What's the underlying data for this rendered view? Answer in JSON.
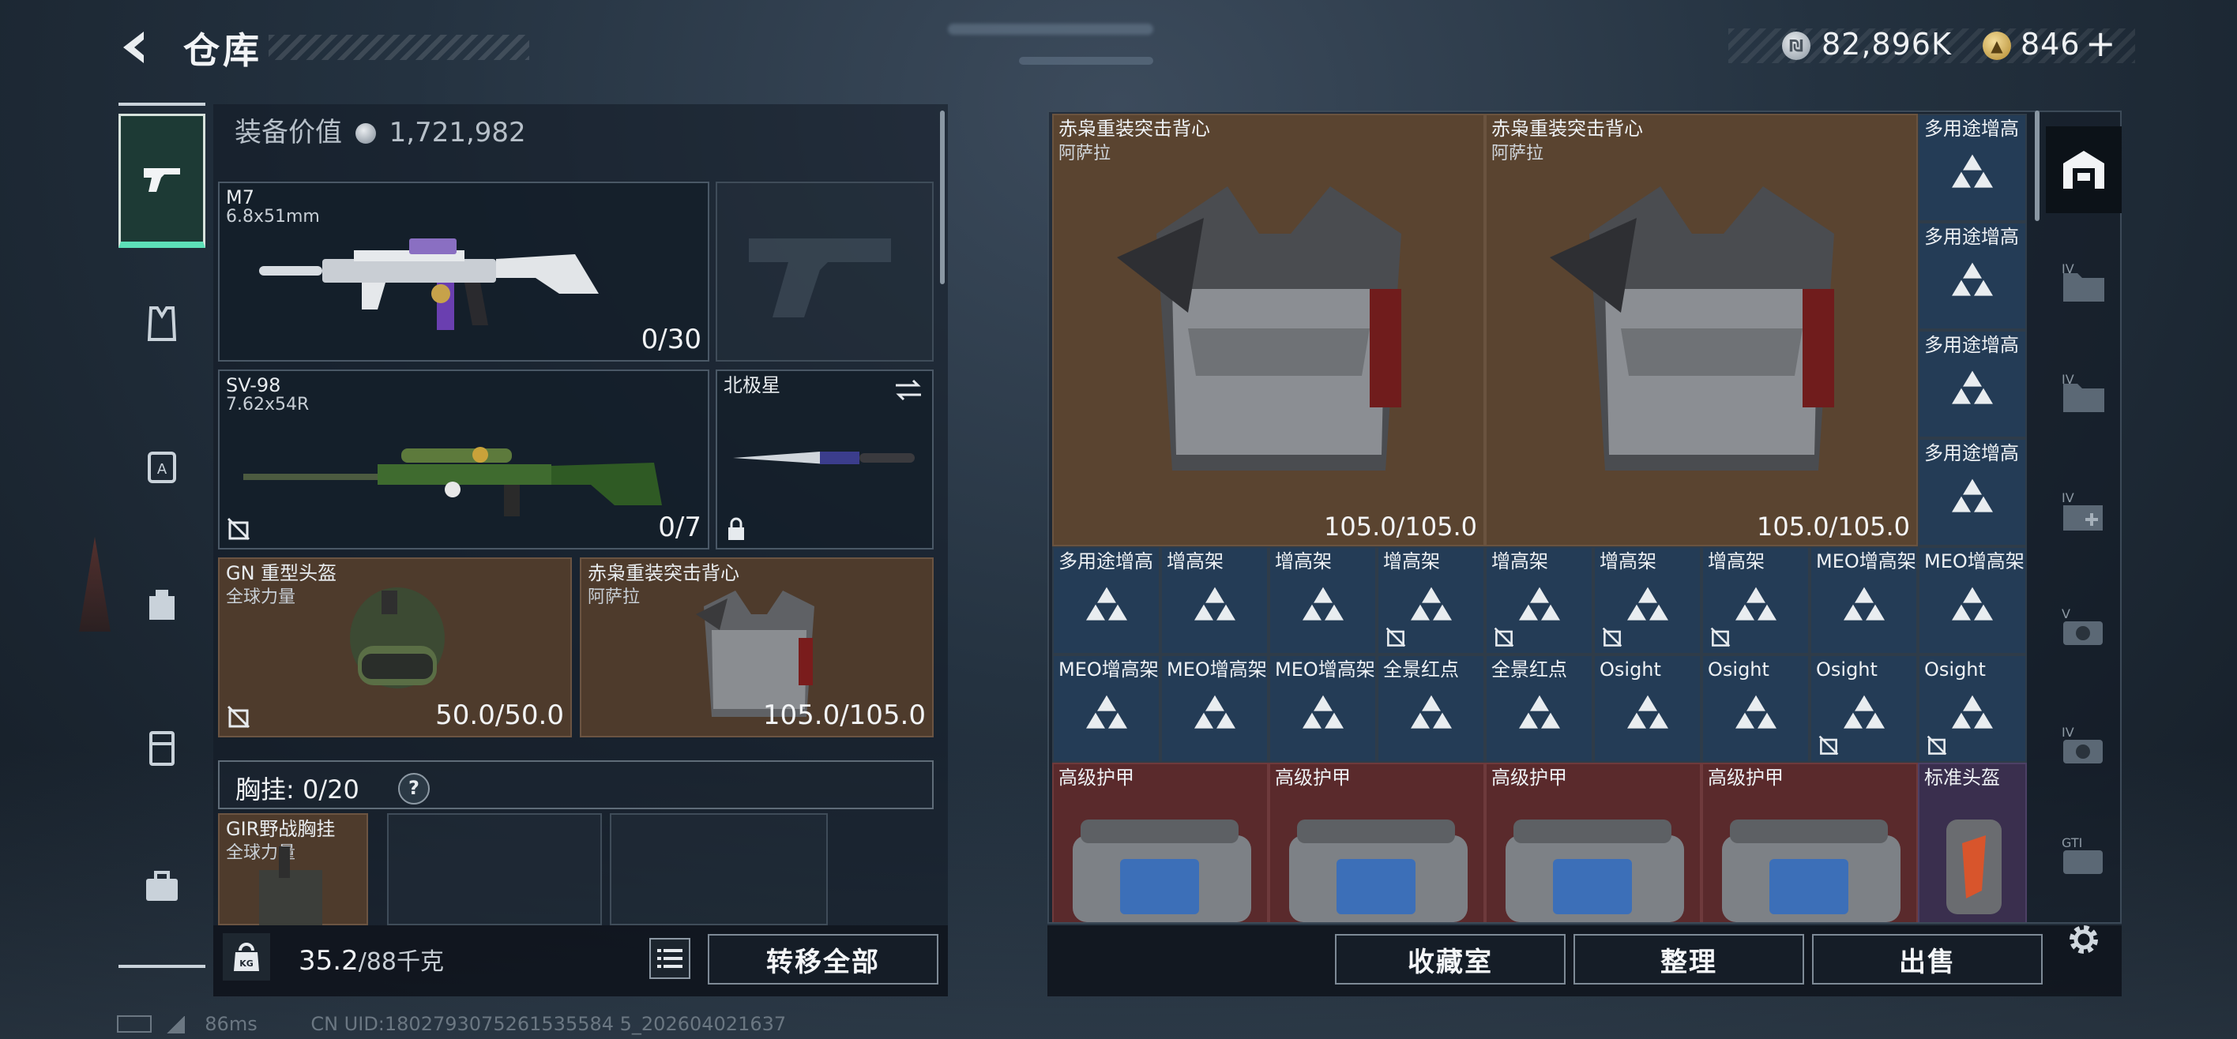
{
  "header": {
    "title": "仓库",
    "currency_silver": "82,896K",
    "currency_gold": "846",
    "add_symbol": "+"
  },
  "categories": [
    {
      "name": "weapons",
      "icon": "pistol-icon"
    },
    {
      "name": "vest",
      "icon": "vest-icon"
    },
    {
      "name": "armor",
      "icon": "armor-icon"
    },
    {
      "name": "backpack",
      "icon": "backpack-icon"
    },
    {
      "name": "chest-rig",
      "icon": "rig-icon"
    },
    {
      "name": "case",
      "icon": "case-icon"
    }
  ],
  "loadout": {
    "equip_value_label": "装备价值",
    "equip_value": "1,721,982",
    "primary": {
      "name": "M7",
      "caliber": "6.8x51mm",
      "ammo": "0/30"
    },
    "secondary": {
      "name": "SV-98",
      "caliber": "7.62x54R",
      "ammo": "0/7"
    },
    "melee": {
      "name": "北极星"
    },
    "helmet": {
      "name": "GN 重型头盔",
      "sub": "全球力量",
      "durability": "50.0/50.0"
    },
    "armor": {
      "name": "赤枭重装突击背心",
      "sub": "阿萨拉",
      "durability": "105.0/105.0"
    },
    "chest_rig_label": "胸挂:",
    "chest_rig_count": "0/20",
    "help": "?",
    "rig": {
      "name": "GIR野战胸挂",
      "sub": "全球力量"
    },
    "weight": "35.2",
    "weight_max": "/88千克",
    "weight_icon_label": "KG",
    "transfer_all": "转移全部"
  },
  "inventory": {
    "big_items": [
      {
        "name": "赤枭重装突击背心",
        "sub": "阿萨拉",
        "durability": "105.0/105.0"
      },
      {
        "name": "赤枭重装突击背心",
        "sub": "阿萨拉",
        "durability": "105.0/105.0"
      }
    ],
    "side_column": [
      "多用途增高",
      "多用途增高",
      "多用途增高",
      "多用途增高"
    ],
    "row1": [
      {
        "name": "多用途增高",
        "locked": false
      },
      {
        "name": "增高架",
        "locked": false
      },
      {
        "name": "增高架",
        "locked": false
      },
      {
        "name": "增高架",
        "locked": true
      },
      {
        "name": "增高架",
        "locked": true
      },
      {
        "name": "增高架",
        "locked": true
      },
      {
        "name": "增高架",
        "locked": true
      },
      {
        "name": "MEO增高架",
        "locked": false
      },
      {
        "name": "MEO增高架",
        "locked": false
      }
    ],
    "row2": [
      {
        "name": "MEO增高架",
        "locked": false
      },
      {
        "name": "MEO增高架",
        "locked": false
      },
      {
        "name": "MEO增高架",
        "locked": false
      },
      {
        "name": "全景红点",
        "locked": false
      },
      {
        "name": "全景红点",
        "locked": false
      },
      {
        "name": "Osight",
        "locked": false
      },
      {
        "name": "Osight",
        "locked": false
      },
      {
        "name": "Osight",
        "locked": true
      },
      {
        "name": "Osight",
        "locked": true
      }
    ],
    "row3": [
      {
        "name": "高级护甲"
      },
      {
        "name": "高级护甲"
      },
      {
        "name": "高级护甲"
      },
      {
        "name": "高级护甲"
      },
      {
        "name": "标准头盔"
      }
    ]
  },
  "actions": {
    "collection": "收藏室",
    "sort": "整理",
    "sell": "出售"
  },
  "right_tabs": [
    {
      "name": "home",
      "icon": "warehouse-icon"
    },
    {
      "name": "tab-iv-1",
      "icon": "folder-iv-icon"
    },
    {
      "name": "tab-iv-2",
      "icon": "folder-iv-icon"
    },
    {
      "name": "tab-iv-3",
      "icon": "medkit-iv-icon"
    },
    {
      "name": "tab-v",
      "icon": "camera-v-icon"
    },
    {
      "name": "tab-iv-4",
      "icon": "camera-iv-icon"
    },
    {
      "name": "tab-gti",
      "icon": "gti-icon"
    }
  ],
  "status": {
    "ping": "86ms",
    "uid": "CN UID:1802793075261535584 5_202604021637"
  },
  "colors": {
    "accent": "#5de0b8",
    "brown_slot": "#5a4430",
    "blue_slot": "#243c56",
    "red_slot": "#5a2a2c"
  }
}
